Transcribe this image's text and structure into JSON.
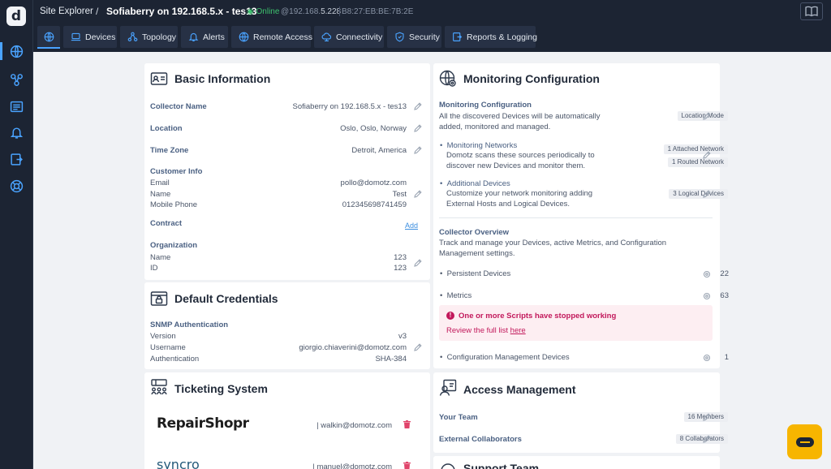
{
  "header": {
    "app": "Site Explorer",
    "separator": "/",
    "site_name": "Sofiaberry on 192.168.5.x - tes13",
    "status": "Online",
    "ip_prefix": "@192.168.",
    "ip_suffix": "5.228",
    "mac": "B8:27:EB:BE:7B:2E"
  },
  "tabs": [
    {
      "label": ""
    },
    {
      "label": "Devices"
    },
    {
      "label": "Topology"
    },
    {
      "label": "Alerts"
    },
    {
      "label": "Remote Access"
    },
    {
      "label": "Connectivity"
    },
    {
      "label": "Security"
    },
    {
      "label": "Reports & Logging"
    }
  ],
  "basic_info": {
    "title": "Basic Information",
    "collector_name_label": "Collector Name",
    "collector_name": "Sofiaberry on 192.168.5.x - tes13",
    "location_label": "Location",
    "location": "Oslo, Oslo, Norway",
    "timezone_label": "Time Zone",
    "timezone": "Detroit, America",
    "customer_info_label": "Customer Info",
    "email_label": "Email",
    "email": "pollo@domotz.com",
    "name_label": "Name",
    "name": "Test",
    "mobile_label": "Mobile Phone",
    "mobile": "012345698741459",
    "contract_label": "Contract",
    "contract_add": "Add",
    "organization_label": "Organization",
    "org_name_label": "Name",
    "org_name": "123",
    "org_id_label": "ID",
    "org_id": "123"
  },
  "default_credentials": {
    "title": "Default Credentials",
    "snmp_label": "SNMP Authentication",
    "version_label": "Version",
    "version": "v3",
    "username_label": "Username",
    "username": "giorgio.chiaverini@domotz.com",
    "auth_label": "Authentication",
    "auth": "SHA-384"
  },
  "ticketing": {
    "title": "Ticketing System",
    "items": [
      {
        "brand": "RepairShopr",
        "account": "| walkin@domotz.com"
      },
      {
        "brand": "syncro",
        "account": "| manuel@domotz.com"
      }
    ]
  },
  "monitoring": {
    "title": "Monitoring Configuration",
    "section_label": "Monitoring Configuration",
    "section_desc": "All the discovered Devices will be automatically added, monitored and managed.",
    "location_mode": "Location Mode",
    "networks_label": "Monitoring Networks",
    "networks_desc": "Domotz scans these sources periodically to discover new Devices and monitor them.",
    "attached_network": "1 Attached Network",
    "routed_network": "1 Routed Network",
    "additional_label": "Additional Devices",
    "additional_desc": "Customize your network monitoring adding External Hosts and Logical Devices.",
    "logical_devices": "3 Logical Devices",
    "overview_label": "Collector Overview",
    "overview_desc": "Track and manage your Devices, active Metrics, and Configuration Management settings.",
    "persistent_label": "Persistent Devices",
    "persistent_count": "22",
    "metrics_label": "Metrics",
    "metrics_count": "63",
    "alert_title": "One or more Scripts have stopped working",
    "alert_body": "Review the full list ",
    "alert_link": "here",
    "config_mgmt_label": "Configuration Management Devices",
    "config_mgmt_count": "1"
  },
  "access_management": {
    "title": "Access Management",
    "team_label": "Your Team",
    "team_badge": "16 Members",
    "collab_label": "External Collaborators",
    "collab_badge": "8 Collaborators"
  },
  "support_team": {
    "title": "Support Team"
  },
  "colors": {
    "accent": "#4aa3ff",
    "online": "#3ec26e",
    "alert": "#c2185b",
    "chat": "#f7b500"
  }
}
